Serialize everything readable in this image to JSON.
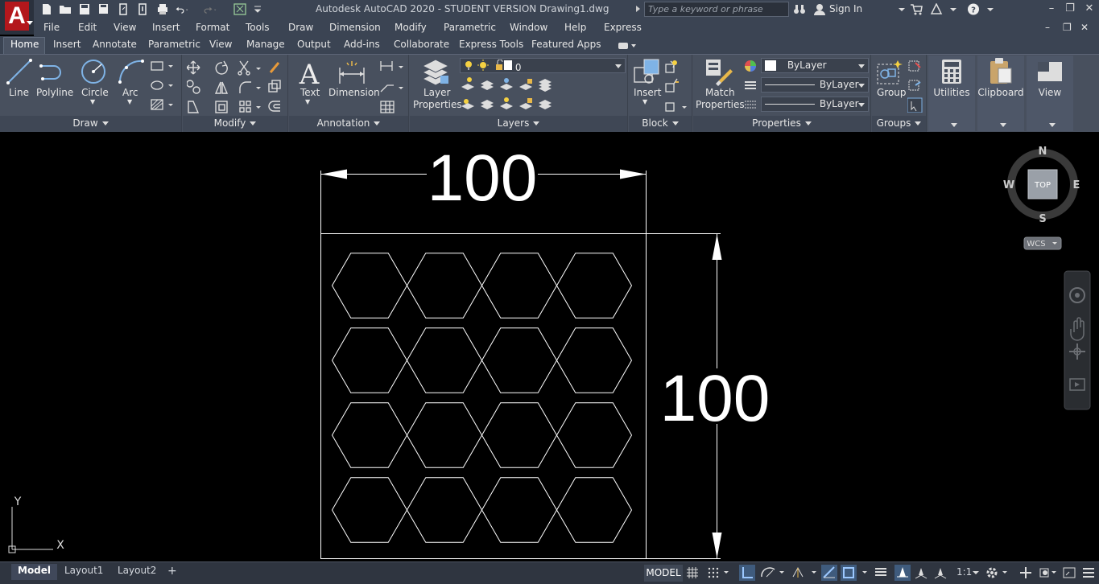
{
  "titlebar": {
    "title": "Autodesk AutoCAD 2020 - STUDENT VERSION   Drawing1.dwg",
    "search_placeholder": "Type a keyword or phrase",
    "sign_in": "Sign In",
    "app_letter": "A"
  },
  "menu": [
    "File",
    "Edit",
    "View",
    "Insert",
    "Format",
    "Tools",
    "Draw",
    "Dimension",
    "Modify",
    "Parametric",
    "Window",
    "Help",
    "Express"
  ],
  "ribbon_tabs": [
    "Home",
    "Insert",
    "Annotate",
    "Parametric",
    "View",
    "Manage",
    "Output",
    "Add-ins",
    "Collaborate",
    "Express Tools",
    "Featured Apps"
  ],
  "panels": {
    "draw": {
      "label": "Draw",
      "line": "Line",
      "polyline": "Polyline",
      "circle": "Circle",
      "arc": "Arc"
    },
    "modify": {
      "label": "Modify"
    },
    "annotation": {
      "label": "Annotation",
      "text": "Text",
      "dimension": "Dimension"
    },
    "layers": {
      "label": "Layers",
      "layer_properties_1": "Layer",
      "layer_properties_2": "Properties",
      "current_layer": "0"
    },
    "block": {
      "label": "Block",
      "insert": "Insert"
    },
    "properties": {
      "label": "Properties",
      "match_1": "Match",
      "match_2": "Properties",
      "color": "ByLayer",
      "linetype": "ByLayer",
      "lineweight": "ByLayer"
    },
    "groups": {
      "label": "Groups",
      "group": "Group"
    },
    "utilities": {
      "label": "Utilities"
    },
    "clipboard": {
      "label": "Clipboard"
    },
    "view": {
      "label": "View"
    }
  },
  "drawing": {
    "dim_horizontal": "100",
    "dim_vertical": "100",
    "hex_rows": 4,
    "hex_cols": 4
  },
  "viewcube": {
    "n": "N",
    "s": "S",
    "e": "E",
    "w": "W",
    "face": "TOP",
    "wcs": "WCS"
  },
  "ucs": {
    "x": "X",
    "y": "Y"
  },
  "status": {
    "layouts": [
      "Model",
      "Layout1",
      "Layout2"
    ],
    "add": "+",
    "model": "MODEL",
    "scale": "1:1"
  }
}
